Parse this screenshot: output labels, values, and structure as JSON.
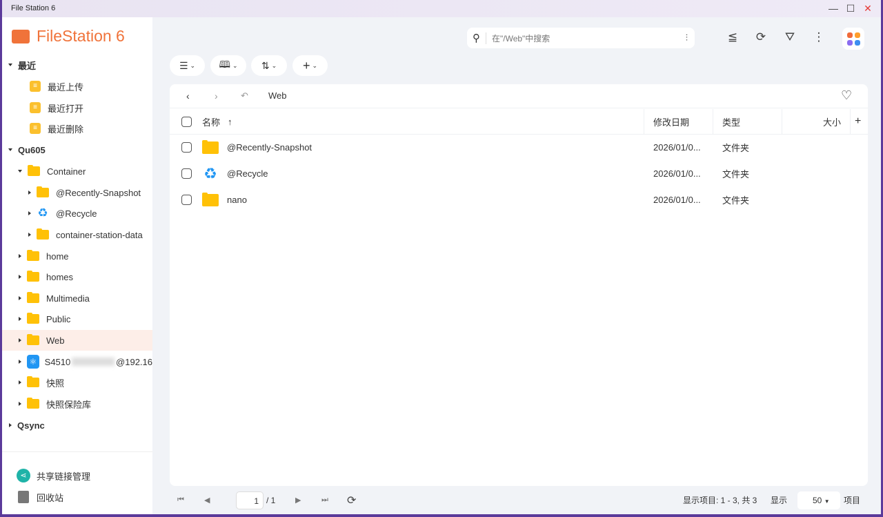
{
  "window": {
    "title": "File Station 6",
    "minimize": "—",
    "maximize": "☐",
    "close": "✕"
  },
  "app": {
    "name": "FileStation 6"
  },
  "search": {
    "placeholder": "在\"/Web\"中搜索"
  },
  "sidebar": {
    "recent": {
      "label": "最近",
      "items": [
        "最近上传",
        "最近打开",
        "最近删除"
      ]
    },
    "nas": {
      "label": "Qu605",
      "items": [
        {
          "label": "Container",
          "level": 1,
          "icon": "folder",
          "expanded": true
        },
        {
          "label": "@Recently-Snapshot",
          "level": 2,
          "icon": "folder"
        },
        {
          "label": "@Recycle",
          "level": 2,
          "icon": "recycle"
        },
        {
          "label": "container-station-data",
          "level": 2,
          "icon": "folder"
        },
        {
          "label": "home",
          "level": 1,
          "icon": "folder"
        },
        {
          "label": "homes",
          "level": 1,
          "icon": "folder"
        },
        {
          "label": "Multimedia",
          "level": 1,
          "icon": "folder"
        },
        {
          "label": "Public",
          "level": 1,
          "icon": "folder"
        },
        {
          "label": "Web",
          "level": 1,
          "icon": "folder",
          "selected": true
        }
      ]
    },
    "remote": {
      "label": "S4510",
      "suffix": "@192.16"
    },
    "snapshot": "快照",
    "vault": "快照保险库",
    "qsync": "Qsync",
    "share_links": "共享链接管理",
    "recycle_bin": "回收站"
  },
  "breadcrumb": {
    "current": "Web"
  },
  "table": {
    "headers": {
      "name": "名称",
      "modified": "修改日期",
      "type": "类型",
      "size": "大小"
    },
    "rows": [
      {
        "name": "@Recently-Snapshot",
        "modified": "2026/01/0...",
        "type": "文件夹",
        "icon": "folder"
      },
      {
        "name": "@Recycle",
        "modified": "2026/01/0...",
        "type": "文件夹",
        "icon": "recycle"
      },
      {
        "name": "nano",
        "modified": "2026/01/0...",
        "type": "文件夹",
        "icon": "folder"
      }
    ]
  },
  "footer": {
    "page": "1",
    "total_pages": "/ 1",
    "summary": "显示项目: 1 - 3, 共 3",
    "show": "显示",
    "per_page": "50",
    "items": "项目"
  },
  "colors": {
    "accent": "#f0733a",
    "folder": "#ffc107",
    "selected": "#fdeee8"
  }
}
